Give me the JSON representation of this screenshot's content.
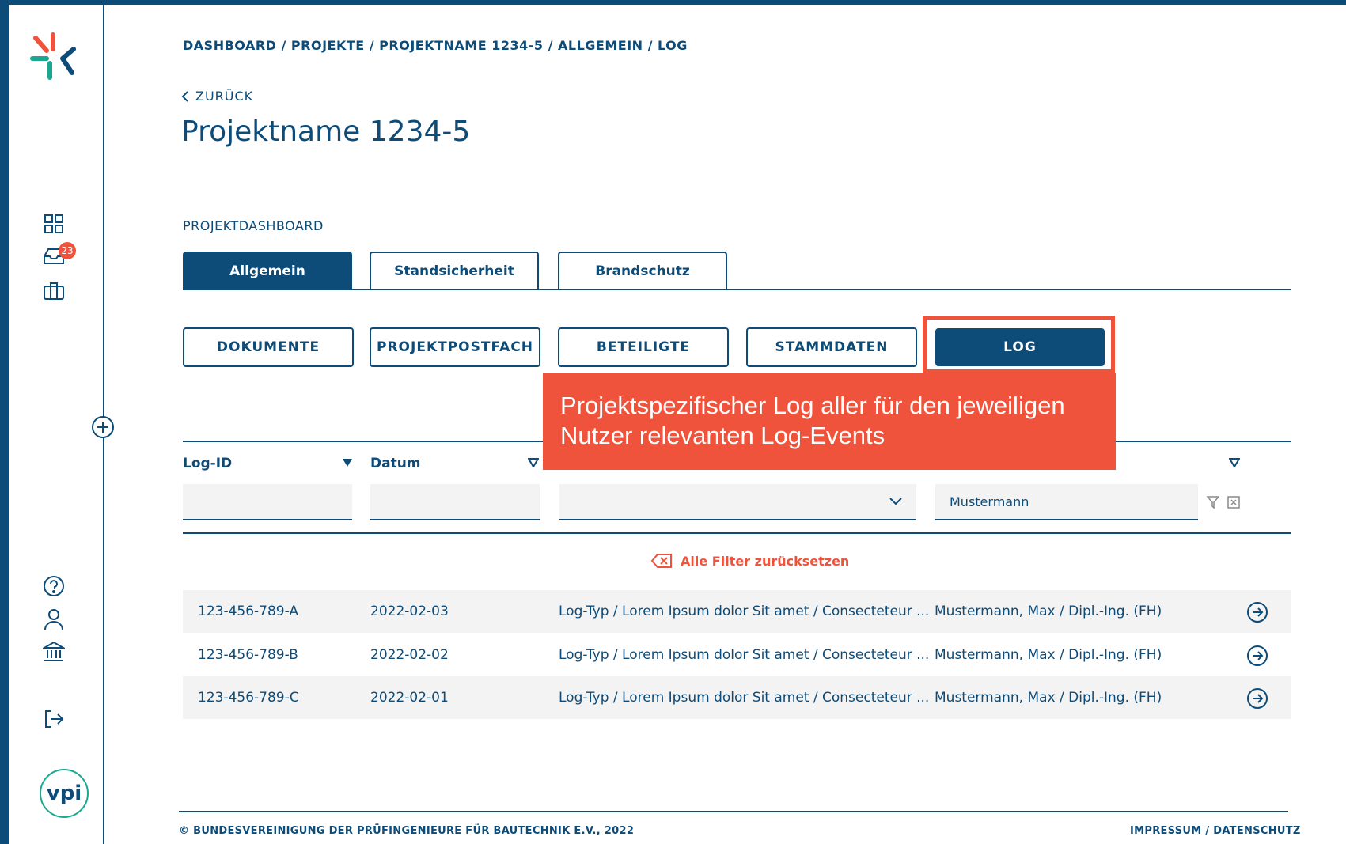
{
  "breadcrumb": "DASHBOARD / PROJEKTE / PROJEKTNAME 1234-5 / ALLGEMEIN / LOG",
  "back_label": "ZURÜCK",
  "page_title": "Projektname 1234-5",
  "section_label": "PROJEKTDASHBOARD",
  "sidebar": {
    "inbox_badge": "23",
    "logo_text": "vpi"
  },
  "tabs": [
    {
      "label": "Allgemein"
    },
    {
      "label": "Standsicherheit"
    },
    {
      "label": "Brandschutz"
    }
  ],
  "subtabs": [
    {
      "label": "DOKUMENTE"
    },
    {
      "label": "PROJEKTPOSTFACH"
    },
    {
      "label": "BETEILIGTE"
    },
    {
      "label": "STAMMDATEN"
    },
    {
      "label": "LOG"
    }
  ],
  "callout": {
    "line1": "Projektspezifischer Log aller für den jeweiligen",
    "line2": "Nutzer relevanten Log-Events"
  },
  "columns": [
    {
      "label": "Log-ID"
    },
    {
      "label": "Datum"
    }
  ],
  "filters": {
    "log_id": "",
    "datum": "",
    "log_typ": "",
    "user": "Mustermann"
  },
  "reset_label": "Alle Filter zurücksetzen",
  "rows": [
    {
      "id": "123-456-789-A",
      "date": "2022-02-03",
      "type": "Log-Typ / Lorem Ipsum dolor Sit amet / Consecteteur ...",
      "user": "Mustermann, Max / Dipl.-Ing. (FH)"
    },
    {
      "id": "123-456-789-B",
      "date": "2022-02-02",
      "type": "Log-Typ / Lorem Ipsum dolor Sit amet / Consecteteur ...",
      "user": "Mustermann, Max / Dipl.-Ing. (FH)"
    },
    {
      "id": "123-456-789-C",
      "date": "2022-02-01",
      "type": "Log-Typ / Lorem Ipsum dolor Sit amet / Consecteteur ...",
      "user": "Mustermann, Max / Dipl.-Ing. (FH)"
    }
  ],
  "footer": {
    "copyright": "© BUNDESVEREINIGUNG DER PRÜFINGENIEURE FÜR BAUTECHNIK E.V., 2022",
    "links": "IMPRESSUM  /  DATENSCHUTZ"
  },
  "colors": {
    "primary": "#0d4b78",
    "accent": "#f0533c",
    "teal": "#1aa890",
    "row_bg": "#f3f3f3"
  }
}
